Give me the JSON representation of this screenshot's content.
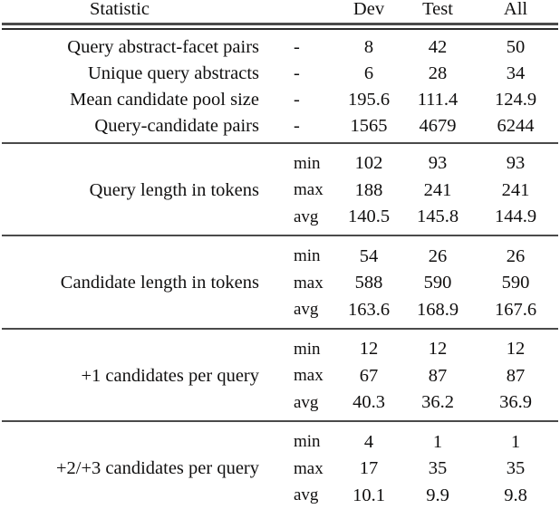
{
  "table": {
    "columns": {
      "statistic": "Statistic",
      "sub": "",
      "dev": "Dev",
      "test": "Test",
      "all": "All"
    },
    "simple_rows": [
      {
        "label": "Query abstract-facet pairs",
        "sub": "-",
        "dev": "8",
        "test": "42",
        "all": "50"
      },
      {
        "label": "Unique query abstracts",
        "sub": "-",
        "dev": "6",
        "test": "28",
        "all": "34"
      },
      {
        "label": "Mean candidate pool size",
        "sub": "-",
        "dev": "195.6",
        "test": "111.4",
        "all": "124.9"
      },
      {
        "label": "Query-candidate pairs",
        "sub": "-",
        "dev": "1565",
        "test": "4679",
        "all": "6244"
      }
    ],
    "groups": [
      {
        "label": "Query length in tokens",
        "rows": [
          {
            "sub": "min",
            "dev": "102",
            "test": "93",
            "all": "93"
          },
          {
            "sub": "max",
            "dev": "188",
            "test": "241",
            "all": "241"
          },
          {
            "sub": "avg",
            "dev": "140.5",
            "test": "145.8",
            "all": "144.9"
          }
        ]
      },
      {
        "label": "Candidate length in tokens",
        "rows": [
          {
            "sub": "min",
            "dev": "54",
            "test": "26",
            "all": "26"
          },
          {
            "sub": "max",
            "dev": "588",
            "test": "590",
            "all": "590"
          },
          {
            "sub": "avg",
            "dev": "163.6",
            "test": "168.9",
            "all": "167.6"
          }
        ]
      },
      {
        "label": "+1 candidates per query",
        "rows": [
          {
            "sub": "min",
            "dev": "12",
            "test": "12",
            "all": "12"
          },
          {
            "sub": "max",
            "dev": "67",
            "test": "87",
            "all": "87"
          },
          {
            "sub": "avg",
            "dev": "40.3",
            "test": "36.2",
            "all": "36.9"
          }
        ]
      },
      {
        "label": "+2/+3 candidates per query",
        "rows": [
          {
            "sub": "min",
            "dev": "4",
            "test": "1",
            "all": "1"
          },
          {
            "sub": "max",
            "dev": "17",
            "test": "35",
            "all": "35"
          },
          {
            "sub": "avg",
            "dev": "10.1",
            "test": "9.9",
            "all": "9.8"
          }
        ]
      }
    ]
  }
}
